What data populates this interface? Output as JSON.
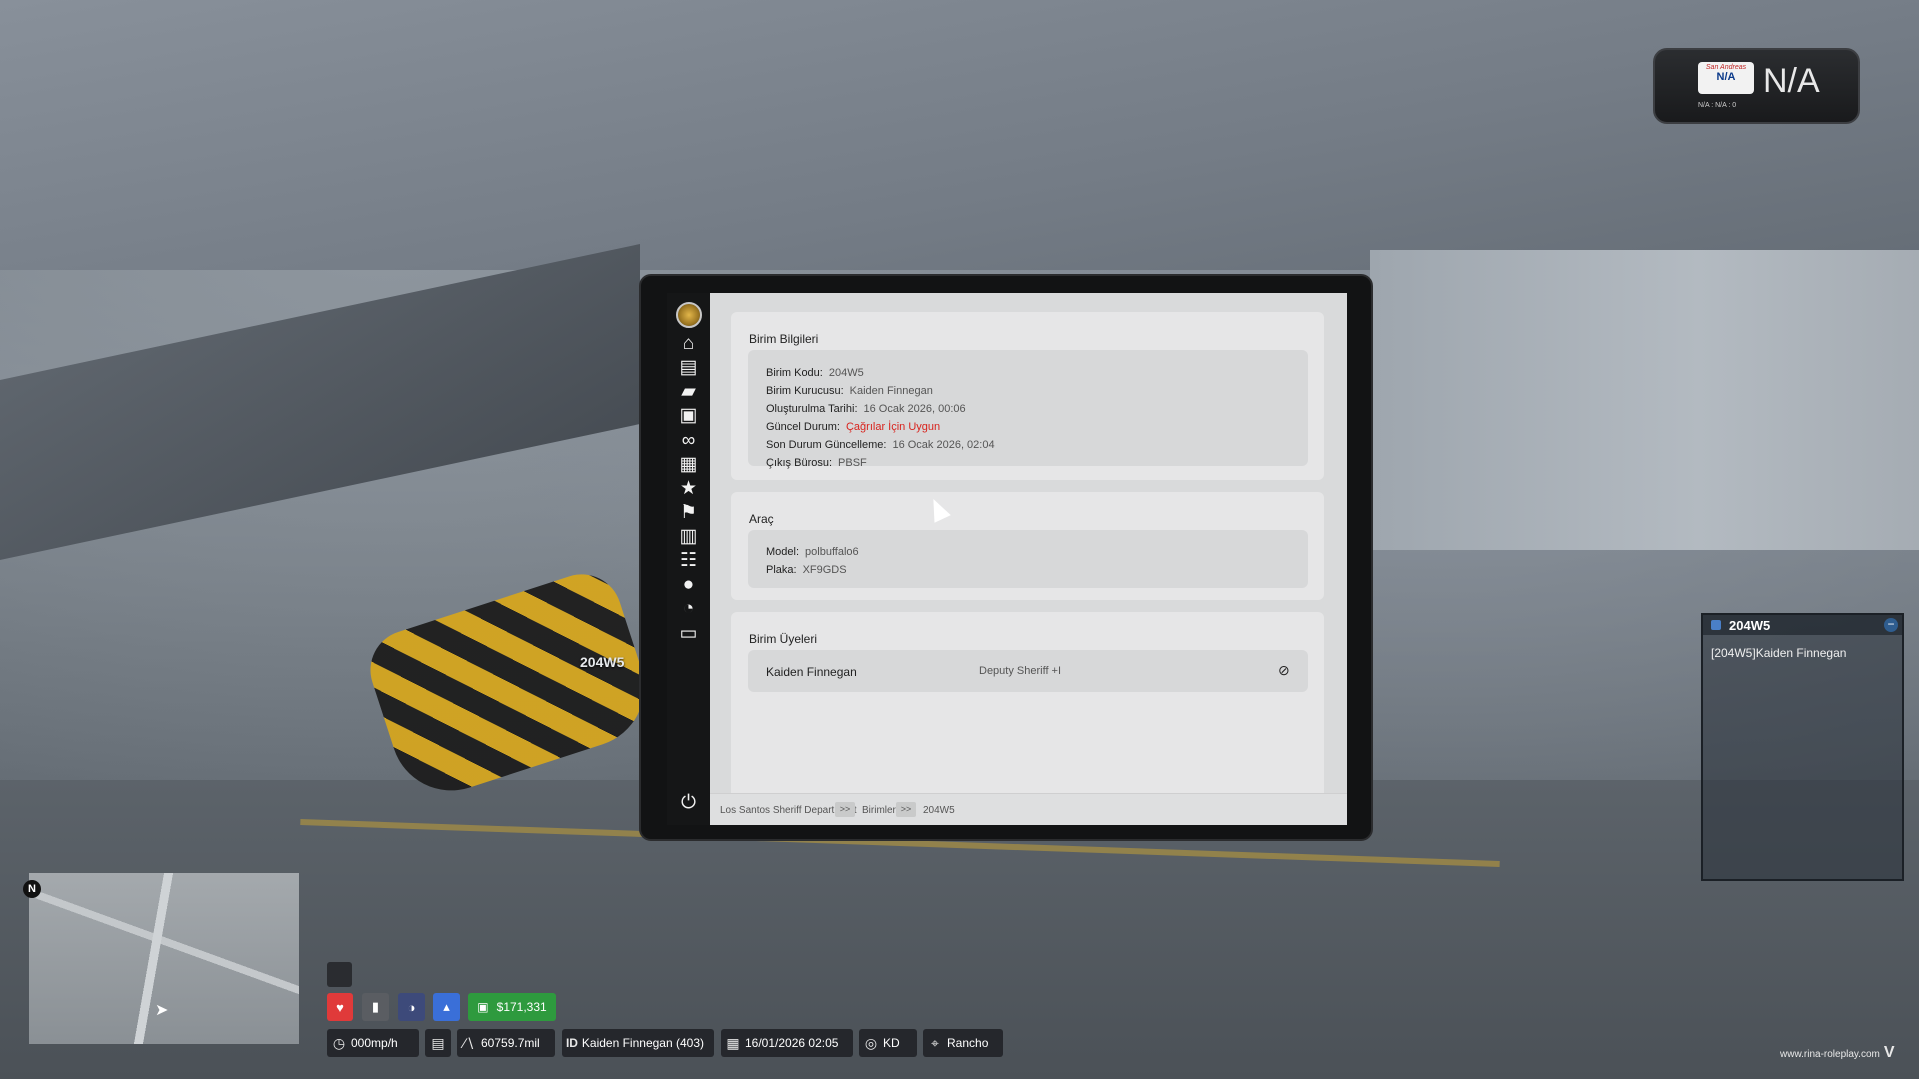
{
  "world": {
    "unit_tag": "204W5"
  },
  "plate_hud": {
    "state": "San Andreas",
    "plate_small": "N/A",
    "plate_big": "N/A",
    "sub": "N/A : N/A : 0"
  },
  "tablet": {
    "sidebar_icons": [
      "badge-icon",
      "home-icon",
      "notes-icon",
      "folder-icon",
      "lock-icon",
      "binoculars-icon",
      "briefcase-icon",
      "star-icon",
      "flag-icon",
      "clipboard-icon",
      "users-icon",
      "user-icon",
      "gauge-icon",
      "archive-icon",
      "power-icon"
    ],
    "unit_info": {
      "title": "Birim Bilgileri",
      "rows": [
        {
          "label": "Birim Kodu:",
          "value": "204W5"
        },
        {
          "label": "Birim Kurucusu:",
          "value": "Kaiden Finnegan"
        },
        {
          "label": "Oluşturulma Tarihi:",
          "value": "16 Ocak 2026, 00:06"
        },
        {
          "label": "Güncel Durum:",
          "value": "Çağrılar İçin Uygun"
        },
        {
          "label": "Son Durum Güncelleme:",
          "value": "16 Ocak 2026, 02:04"
        },
        {
          "label": "Çıkış Bürosu:",
          "value": "PBSF"
        }
      ]
    },
    "vehicle": {
      "title": "Araç",
      "rows": [
        {
          "label": "Model:",
          "value": "polbuffalo6"
        },
        {
          "label": "Plaka:",
          "value": "XF9GDS"
        }
      ]
    },
    "members": {
      "title": "Birim Üyeleri",
      "list": [
        {
          "name": "Kaiden Finnegan",
          "rank": "Deputy Sheriff +I"
        }
      ]
    },
    "breadcrumb": {
      "items": [
        "Los Santos Sheriff Department",
        "Birimler",
        "204W5"
      ],
      "separator": ">>"
    }
  },
  "unit_panel": {
    "title": "204W5",
    "minimize": "−",
    "line": "[204W5]Kaiden Finnegan"
  },
  "minimap": {
    "compass": "N"
  },
  "hud": {
    "money": "$171,331",
    "speed": "000mp/h",
    "mileage": "60759.7mil",
    "id_label": "ID",
    "player": "Kaiden Finnegan (403)",
    "datetime": "16/01/2026 02:05",
    "direction": "KD",
    "location": "Rancho",
    "colors": {
      "health": "#e03a3a",
      "thirst": "#3a6fd8",
      "money": "#2e9a3e"
    }
  },
  "watermark": {
    "text": "www.rina-roleplay.com",
    "logo": "V"
  }
}
